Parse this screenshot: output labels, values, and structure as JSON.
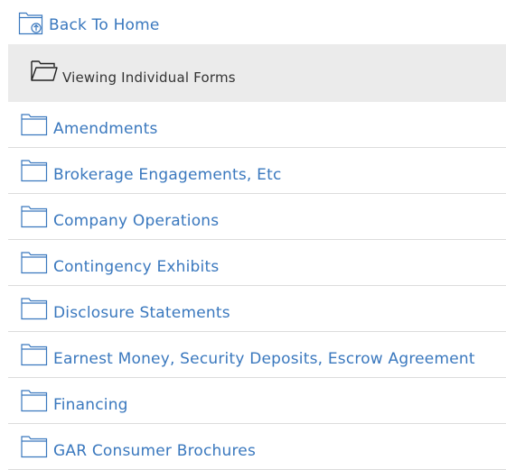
{
  "back_link": {
    "label": "Back To Home",
    "icon": "folder-up-icon"
  },
  "current_folder": {
    "label": "Viewing Individual Forms",
    "icon": "open-folder-icon"
  },
  "colors": {
    "link": "#3a78be",
    "current_bg": "#ebebeb",
    "divider": "#dcdcdc"
  },
  "folders": [
    {
      "label": "Amendments",
      "icon": "folder-icon"
    },
    {
      "label": "Brokerage Engagements, Etc",
      "icon": "folder-icon"
    },
    {
      "label": "Company Operations",
      "icon": "folder-icon"
    },
    {
      "label": "Contingency Exhibits",
      "icon": "folder-icon"
    },
    {
      "label": "Disclosure Statements",
      "icon": "folder-icon"
    },
    {
      "label": "Earnest Money, Security Deposits, Escrow Agreement",
      "icon": "folder-icon"
    },
    {
      "label": "Financing",
      "icon": "folder-icon"
    },
    {
      "label": "GAR Consumer Brochures",
      "icon": "folder-icon"
    }
  ]
}
